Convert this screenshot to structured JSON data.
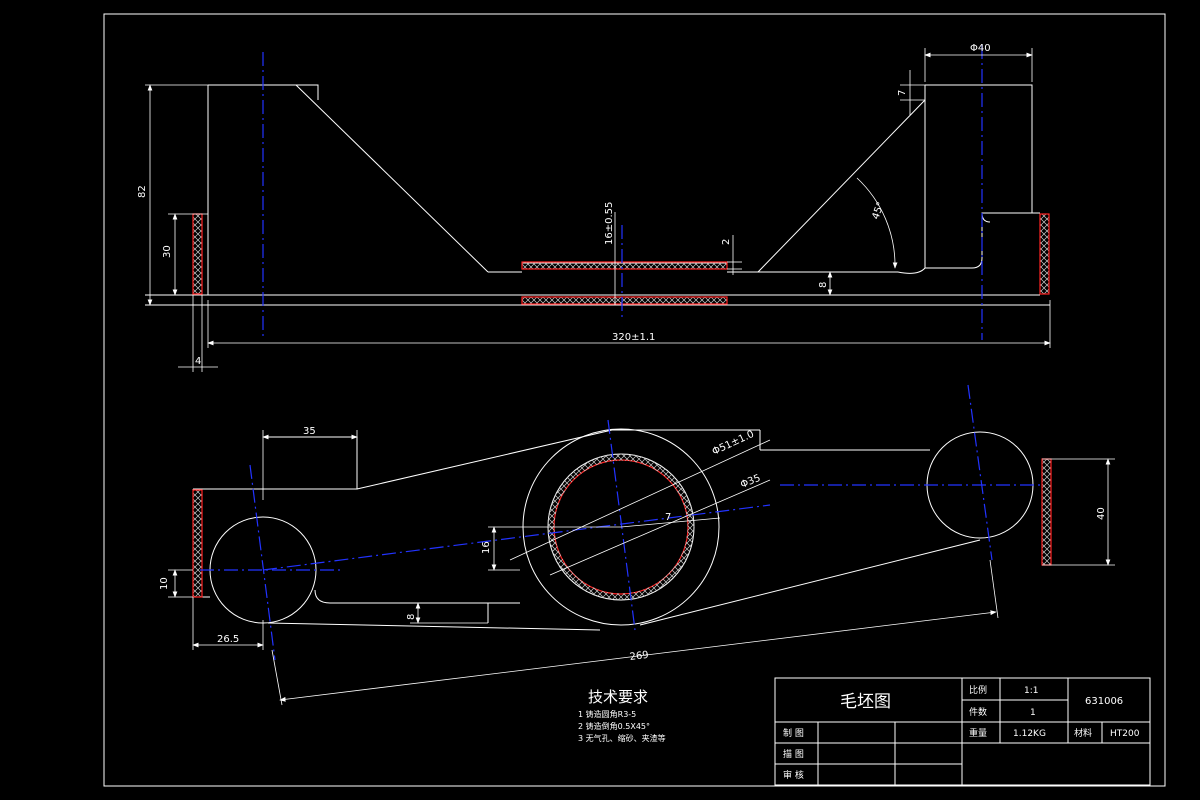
{
  "dimensions": {
    "d40": "Φ40",
    "d7": "7",
    "h82": "82",
    "h30": "30",
    "h16": "16±0.55",
    "d2": "2",
    "d8": "8",
    "a45": "45°",
    "len320": "320±1.1",
    "w4": "4",
    "w35": "35",
    "phi51": "Φ51±1.0",
    "phi35": "Φ35",
    "a7": "7",
    "h16b": "16",
    "h10": "10",
    "h8b": "8",
    "w265": "26.5",
    "len269": "269",
    "h40": "40"
  },
  "tech": {
    "heading": "技术要求",
    "items": [
      "1  铸造圆角R3-5",
      "2  铸造倒角0.5X45°",
      "3  无气孔、缩砂、夹渣等"
    ]
  },
  "titleblock": {
    "name": "毛坯图",
    "scale_label": "比例",
    "scale_value": "1:1",
    "qty_label": "件数",
    "qty_value": "1",
    "code": "631006",
    "weight_label": "重量",
    "weight_value": "1.12KG",
    "material_label": "材料",
    "material_value": "HT200",
    "drawn_label": "制 图",
    "check_label": "描 图",
    "review_label": "审 核"
  }
}
